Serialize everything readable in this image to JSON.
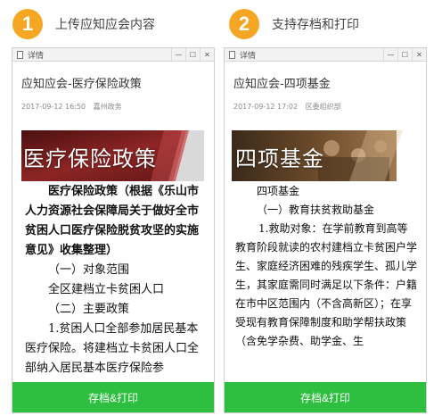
{
  "steps": [
    {
      "num": "1",
      "text": "上传应知应会内容"
    },
    {
      "num": "2",
      "text": "支持存档和打印"
    }
  ],
  "window": {
    "title": "详情",
    "min_glyph": "—",
    "max_glyph": "☐",
    "close_glyph": "✕"
  },
  "panels": [
    {
      "title": "应知应会-医疗保险政策",
      "date": "2017-09-12 16:50",
      "org": "嘉州政务",
      "banner": "医疗保险政策",
      "paragraphs": [
        "医疗保险政策（根据《乐山市人力资源社会保障局关于做好全市贫困人口医疗保险脱贫攻坚的实施意见》收集整理）",
        "（一）对象范围",
        "全区建档立卡贫困人口",
        "（二）主要政策",
        "1.贫困人口全部参加居民基本医疗保险。将建档立卡贫困人口全部纳入居民基本医疗保险参"
      ],
      "button": "存档&打印"
    },
    {
      "title": "应知应会-四项基金",
      "date": "2017-09-12 17:02",
      "org": "区委组织部",
      "banner": "四项基金",
      "paragraphs": [
        "四项基金",
        "（一）教育扶贫救助基金",
        "1.救助对象：在学前教育到高等教育阶段就读的农村建档立卡贫困户学生、家庭经济困难的残疾学生、孤儿学生，其家庭需同时满足以下条件：户籍在市中区范围内（不含高新区）；在享受现有教育保障制度和助学帮扶政策（含免学杂费、助学金、生"
      ],
      "button": "存档&打印"
    }
  ],
  "colors": {
    "step_badge": "#f5a623",
    "button": "#2fbf40",
    "banner_left": "#7a1c1c",
    "banner_right": "#8a5a2a"
  }
}
